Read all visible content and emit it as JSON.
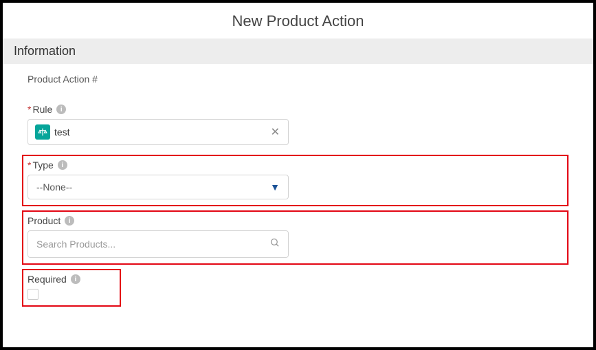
{
  "title": "New Product Action",
  "section": "Information",
  "productActionNumber": {
    "label": "Product Action #"
  },
  "fields": {
    "rule": {
      "label": "Rule",
      "required": true,
      "value": "test"
    },
    "type": {
      "label": "Type",
      "required": true,
      "selected": "--None--"
    },
    "product": {
      "label": "Product",
      "placeholder": "Search Products..."
    },
    "requiredField": {
      "label": "Required",
      "checked": false
    }
  }
}
